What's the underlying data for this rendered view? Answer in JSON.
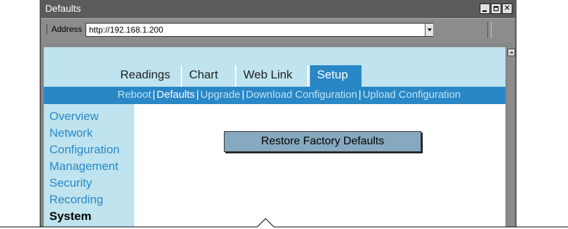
{
  "window": {
    "title": "Defaults"
  },
  "address": {
    "label": "Address",
    "url": "http://192.168.1.200"
  },
  "tabs": [
    {
      "label": "Readings"
    },
    {
      "label": "Chart"
    },
    {
      "label": "Web Link"
    },
    {
      "label": "Setup"
    }
  ],
  "subnav": {
    "items": [
      "Reboot",
      "Defaults",
      "Upgrade",
      "Download Configuration",
      "Upload Configuration"
    ]
  },
  "sidebar": {
    "items": [
      {
        "label": "Overview"
      },
      {
        "label": "Network"
      },
      {
        "label": "Configuration"
      },
      {
        "label": "Management"
      },
      {
        "label": "Security"
      },
      {
        "label": "Recording"
      },
      {
        "label": "System"
      }
    ]
  },
  "main": {
    "restore_button": "Restore Factory Defaults"
  },
  "colors": {
    "accent": "#2a87c6",
    "light": "#bfe4ef",
    "button": "#87a9bf"
  },
  "icons": [
    "minimize-icon",
    "maximize-icon",
    "close-icon",
    "dropdown-arrow-icon",
    "scroll-up-icon"
  ]
}
